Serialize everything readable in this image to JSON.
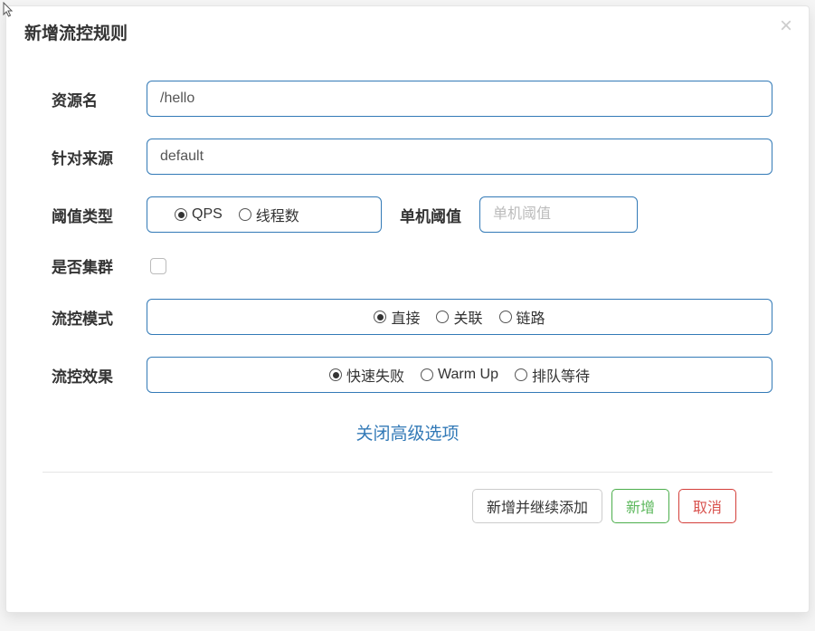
{
  "modal": {
    "title": "新增流控规则"
  },
  "form": {
    "resource_label": "资源名",
    "resource_value": "/hello",
    "source_label": "针对来源",
    "source_value": "default",
    "threshold_type_label": "阈值类型",
    "threshold_type_options": {
      "qps": "QPS",
      "threads": "线程数"
    },
    "single_threshold_label": "单机阈值",
    "single_threshold_placeholder": "单机阈值",
    "cluster_label": "是否集群",
    "flow_mode_label": "流控模式",
    "flow_mode_options": {
      "direct": "直接",
      "relate": "关联",
      "chain": "链路"
    },
    "flow_effect_label": "流控效果",
    "flow_effect_options": {
      "fail_fast": "快速失败",
      "warm_up": "Warm Up",
      "queue": "排队等待"
    },
    "advanced_link": "关闭高级选项"
  },
  "footer": {
    "add_continue": "新增并继续添加",
    "add": "新增",
    "cancel": "取消"
  }
}
